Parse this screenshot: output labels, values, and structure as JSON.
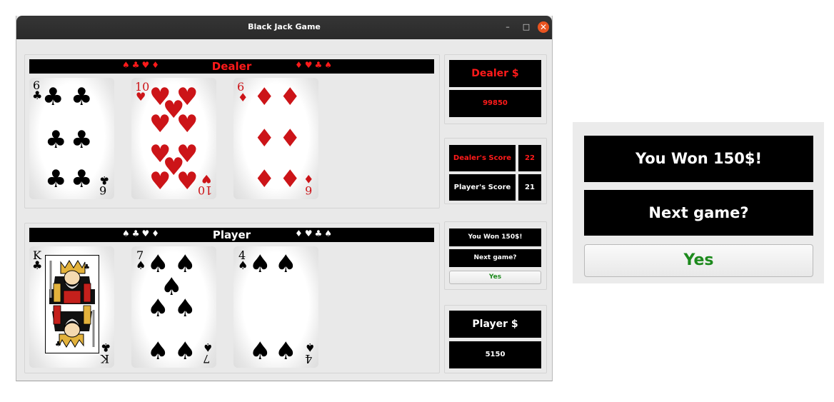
{
  "window": {
    "title": "Black Jack Game",
    "minimize_glyph": "–",
    "maximize_glyph": "□",
    "close_glyph": "✕"
  },
  "dealer": {
    "banner_label": "Dealer",
    "banner_suits_left": "♠♣♥♦",
    "banner_suits_right": "♦♥♣♠",
    "cards": [
      {
        "rank": "6",
        "suit": "♣",
        "color": "black"
      },
      {
        "rank": "10",
        "suit": "♥",
        "color": "red"
      },
      {
        "rank": "6",
        "suit": "♦",
        "color": "red"
      }
    ]
  },
  "player": {
    "banner_label": "Player",
    "banner_suits_left": "♠♣♥♦",
    "banner_suits_right": "♦♥♣♠",
    "cards": [
      {
        "rank": "K",
        "suit": "♣",
        "color": "black"
      },
      {
        "rank": "7",
        "suit": "♠",
        "color": "black"
      },
      {
        "rank": "4",
        "suit": "♠",
        "color": "black"
      }
    ]
  },
  "side": {
    "dealer_money_label": "Dealer $",
    "dealer_money_value": "99850",
    "dealer_score_label": "Dealer's Score",
    "dealer_score_value": "22",
    "player_score_label": "Player's Score",
    "player_score_value": "21",
    "result_text": "You Won 150$!",
    "next_game_text": "Next game?",
    "yes_label": "Yes",
    "player_money_label": "Player $",
    "player_money_value": "5150"
  },
  "colors": {
    "red_text": "#ff1a1a",
    "card_red": "#cc1418",
    "yes_green": "#1d8a1d",
    "close_button": "#e95420"
  },
  "icons": {
    "club": "♣",
    "spade": "♠",
    "heart": "♥",
    "diamond": "♦"
  }
}
